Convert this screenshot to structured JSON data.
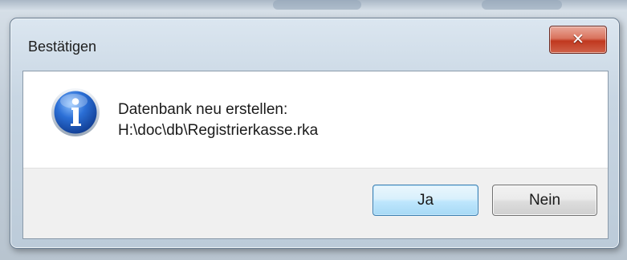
{
  "dialog": {
    "title": "Bestätigen",
    "close_icon": "close-icon",
    "message": {
      "icon": "info-icon",
      "line1": "Datenbank neu erstellen:",
      "line2": "H:\\doc\\db\\Registrierkasse.rka"
    },
    "buttons": {
      "yes_label": "Ja",
      "no_label": "Nein"
    }
  },
  "colors": {
    "close_button": "#c9452c",
    "default_button_border": "#3c7fb1",
    "info_icon_blue": "#1f57b8"
  }
}
